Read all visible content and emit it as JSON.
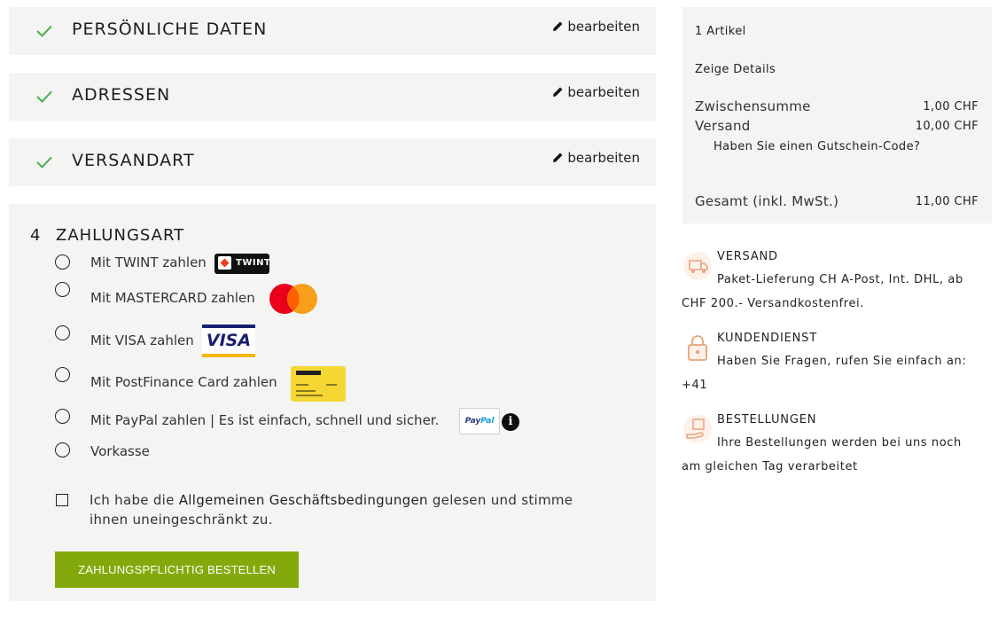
{
  "steps": [
    {
      "title": "PERSÖNLICHE DATEN",
      "edit_label": "bearbeiten"
    },
    {
      "title": "ADRESSEN",
      "edit_label": "bearbeiten"
    },
    {
      "title": "VERSANDART",
      "edit_label": "bearbeiten"
    }
  ],
  "payment": {
    "step_number": "4",
    "title": "ZAHLUNGSART",
    "options": [
      {
        "label": "Mit TWINT zahlen",
        "logo_text": "TWINT"
      },
      {
        "label": "Mit MASTERCARD zahlen"
      },
      {
        "label": "Mit VISA zahlen",
        "logo_text": "VISA"
      },
      {
        "label": "Mit PostFinance Card zahlen"
      },
      {
        "label": "Mit PayPal zahlen | Es ist einfach, schnell und sicher.",
        "logo_text_pay": "Pay",
        "logo_text_pal": "Pal",
        "info_symbol": "i"
      },
      {
        "label": "Vorkasse"
      }
    ],
    "terms_prefix": "Ich habe die ",
    "terms_link": "Allgemeinen Geschäftsbedingungen",
    "terms_suffix": " gelesen und stimme ihnen uneingeschränkt zu.",
    "order_button": "ZAHLUNGSPFLICHTIG BESTELLEN"
  },
  "summary": {
    "item_count": "1 Artikel",
    "show_details": "Zeige Details",
    "subtotal_label": "Zwischensumme",
    "subtotal_value": "1,00 CHF",
    "shipping_label": "Versand",
    "shipping_value": "10,00 CHF",
    "voucher_link": "Haben Sie einen Gutschein-Code?",
    "total_label": "Gesamt (inkl. MwSt.)",
    "total_value": "11,00 CHF"
  },
  "info": [
    {
      "title": "VERSAND",
      "text": "Paket-Lieferung CH A-Post, Int. DHL, ab CHF 200.- Versandkostenfrei.",
      "icon": "truck-icon"
    },
    {
      "title": "KUNDENDIENST",
      "text": "Haben Sie Fragen, rufen Sie einfach an: +41",
      "icon": "lock-icon"
    },
    {
      "title": "BESTELLUNGEN",
      "text": "Ihre Bestellungen werden bei uns noch am gleichen Tag verarbeitet",
      "icon": "hand-box-icon"
    }
  ],
  "colors": {
    "check": "#4caf50",
    "button": "#84a90c",
    "panel": "#f4f4f3",
    "icon_accent": "#e8a27a"
  }
}
